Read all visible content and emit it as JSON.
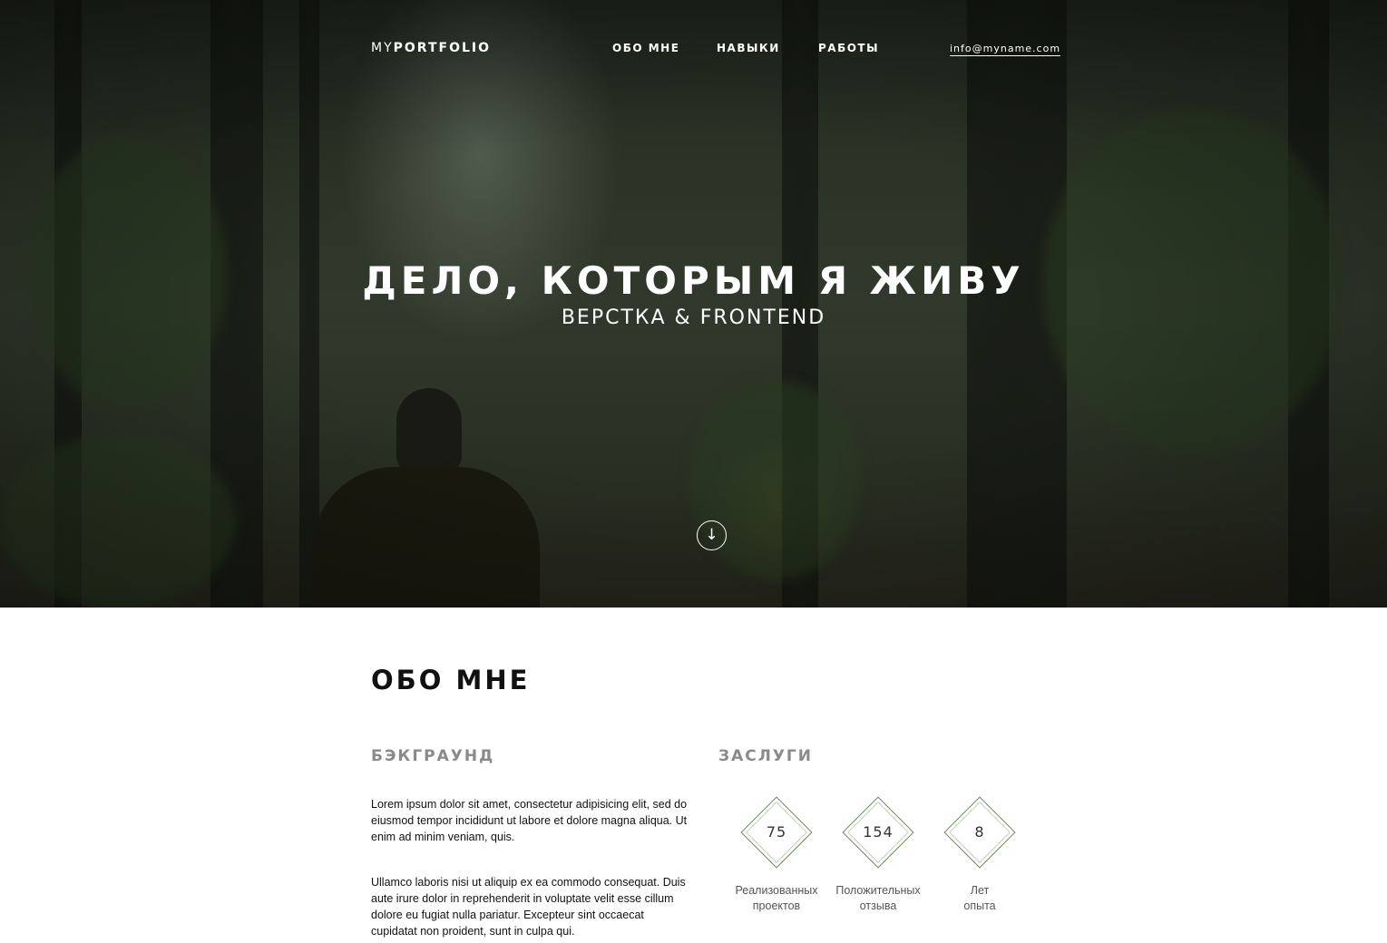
{
  "header": {
    "logo_light": "MY",
    "logo_bold": "PORTFOLIO",
    "nav": [
      {
        "label": "ОБО МНЕ"
      },
      {
        "label": "НАВЫКИ"
      },
      {
        "label": "РАБОТЫ"
      }
    ],
    "email": "info@myname.com"
  },
  "hero": {
    "title": "ДЕЛО, КОТОРЫМ Я ЖИВУ",
    "subtitle": "ВЕРСТКА & FRONTEND",
    "scroll_icon": "arrow-down-icon",
    "scroll_glyph": "↓"
  },
  "about": {
    "title": "ОБО МНЕ",
    "background": {
      "title": "БЭКГРАУНД",
      "paragraphs": [
        "Lorem ipsum dolor sit amet, consectetur adipisicing elit, sed do eiusmod tempor incididunt ut labore et dolore magna aliqua. Ut enim ad minim veniam, quis.",
        "Ullamco laboris nisi ut aliquip ex ea commodo consequat. Duis aute irure dolor in reprehenderit in voluptate velit esse cillum dolore eu fugiat nulla pariatur. Excepteur sint occaecat cupidatat non proident, sunt in culpa qui."
      ]
    },
    "merits": {
      "title": "ЗАСЛУГИ",
      "stats": [
        {
          "value": "75",
          "label_line1": "Реализованных",
          "label_line2": "проектов"
        },
        {
          "value": "154",
          "label_line1": "Положительных",
          "label_line2": "отзыва"
        },
        {
          "value": "8",
          "label_line1": "Лет",
          "label_line2": "опыта"
        }
      ]
    }
  },
  "colors": {
    "accent": "#6e8a5e",
    "heading": "#111111",
    "subheading": "#8a8a8a"
  }
}
